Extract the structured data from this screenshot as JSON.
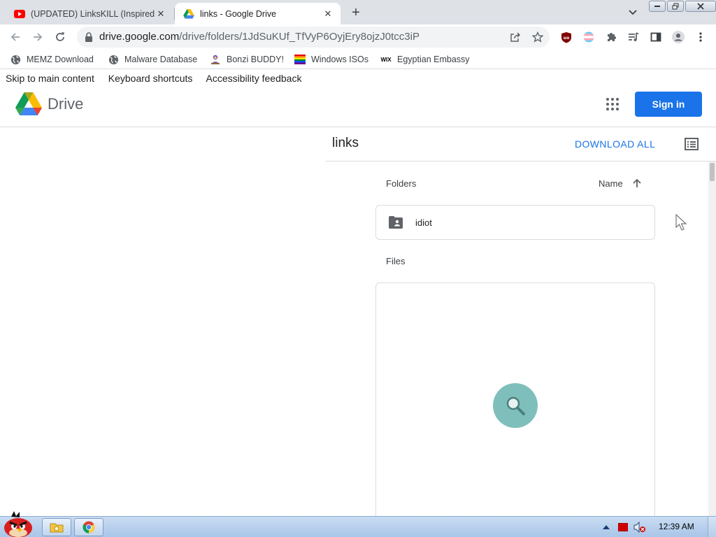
{
  "browser": {
    "tabs": [
      {
        "title": "(UPDATED) LinksKILL (Inspired",
        "favicon": "youtube-icon",
        "active": false
      },
      {
        "title": "links - Google Drive",
        "favicon": "google-drive-icon",
        "active": true
      }
    ],
    "url_host": "drive.google.com",
    "url_path": "/drive/folders/1JdSuKUf_TfVyP6OyjEry8ojzJ0tcc3iP",
    "bookmarks": [
      {
        "label": "MEMZ Download",
        "icon": "globe-icon"
      },
      {
        "label": "Malware Database",
        "icon": "globe-icon"
      },
      {
        "label": "Bonzi BUDDY!",
        "icon": "bonzi-icon"
      },
      {
        "label": "Windows ISOs",
        "icon": "rainbow-flag-icon"
      },
      {
        "label": "Egyptian Embassy",
        "icon": "wix-icon"
      }
    ],
    "wix_text": "WIX"
  },
  "page": {
    "skip_links": [
      "Skip to main content",
      "Keyboard shortcuts",
      "Accessibility feedback"
    ],
    "brand": "Drive",
    "sign_in": "Sign in",
    "folder_title": "links",
    "download_all": "DOWNLOAD ALL",
    "folders_label": "Folders",
    "sort_label": "Name",
    "folders": [
      {
        "name": "idiot"
      }
    ],
    "files_label": "Files"
  },
  "taskbar": {
    "clock": "12:39 AM"
  },
  "colors": {
    "accent": "#1a73e8",
    "loader": "#7fbfbb"
  }
}
